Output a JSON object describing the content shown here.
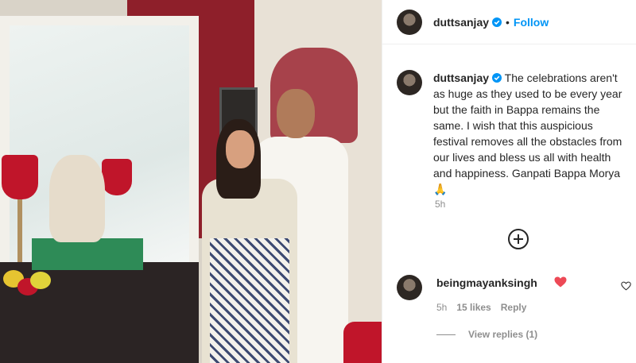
{
  "header": {
    "username": "duttsanjay",
    "separator": "•",
    "follow_label": "Follow"
  },
  "caption": {
    "username": "duttsanjay",
    "text": "The celebrations aren't as huge as they used to be every year but the faith in Bappa remains the same. I wish that this auspicious festival removes all the obstacles from our lives and bless us all with health and happiness. Ganpati Bappa Morya",
    "emoji": "🙏",
    "time": "5h"
  },
  "comment": {
    "username": "beingmayanksingh",
    "time": "5h",
    "likes": "15 likes",
    "reply_label": "Reply",
    "view_replies": "View replies (1)"
  },
  "colors": {
    "accent": "#0095f6",
    "heart": "#ed4956",
    "muted": "#8e8e8e"
  },
  "icons": [
    "verified-badge-icon",
    "heart-emoji-icon",
    "add-circle-icon",
    "like-heart-icon"
  ]
}
